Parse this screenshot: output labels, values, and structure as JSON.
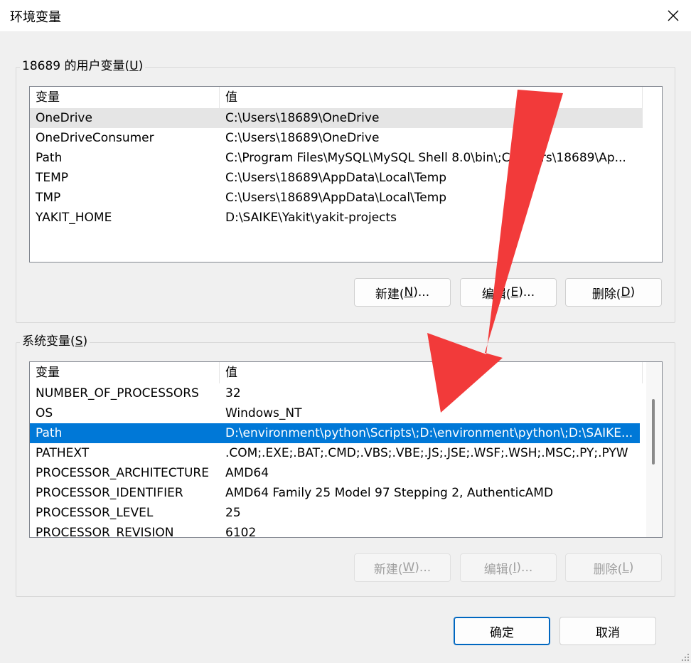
{
  "window": {
    "title": "环境变量"
  },
  "user_vars": {
    "group_label_prefix": "18689 的用户变量(",
    "group_label_accel": "U",
    "group_label_suffix": ")",
    "columns": [
      "变量",
      "值"
    ],
    "rows": [
      {
        "name": "OneDrive",
        "value": "C:\\Users\\18689\\OneDrive"
      },
      {
        "name": "OneDriveConsumer",
        "value": "C:\\Users\\18689\\OneDrive"
      },
      {
        "name": "Path",
        "value": "C:\\Program Files\\MySQL\\MySQL Shell 8.0\\bin\\;C:\\Users\\18689\\Ap..."
      },
      {
        "name": "TEMP",
        "value": "C:\\Users\\18689\\AppData\\Local\\Temp"
      },
      {
        "name": "TMP",
        "value": "C:\\Users\\18689\\AppData\\Local\\Temp"
      },
      {
        "name": "YAKIT_HOME",
        "value": "D:\\SAIKE\\Yakit\\yakit-projects"
      }
    ],
    "buttons": {
      "new": {
        "pre": "新建(",
        "accel": "N",
        "post": ")..."
      },
      "edit": {
        "pre": "编辑(",
        "accel": "E",
        "post": ")..."
      },
      "delete": {
        "pre": "删除(",
        "accel": "D",
        "post": ")"
      }
    }
  },
  "system_vars": {
    "group_label_prefix": "系统变量(",
    "group_label_accel": "S",
    "group_label_suffix": ")",
    "columns": [
      "变量",
      "值"
    ],
    "rows": [
      {
        "name": "NUMBER_OF_PROCESSORS",
        "value": "32"
      },
      {
        "name": "OS",
        "value": "Windows_NT"
      },
      {
        "name": "Path",
        "value": "D:\\environment\\python\\Scripts\\;D:\\environment\\python\\;D:\\SAIKE..."
      },
      {
        "name": "PATHEXT",
        "value": ".COM;.EXE;.BAT;.CMD;.VBS;.VBE;.JS;.JSE;.WSF;.WSH;.MSC;.PY;.PYW"
      },
      {
        "name": "PROCESSOR_ARCHITECTURE",
        "value": "AMD64"
      },
      {
        "name": "PROCESSOR_IDENTIFIER",
        "value": "AMD64 Family 25 Model 97 Stepping 2, AuthenticAMD"
      },
      {
        "name": "PROCESSOR_LEVEL",
        "value": "25"
      },
      {
        "name": "PROCESSOR_REVISION",
        "value": "6102"
      }
    ],
    "selected_row": 2,
    "buttons": {
      "new": {
        "pre": "新建(",
        "accel": "W",
        "post": ")..."
      },
      "edit": {
        "pre": "编辑(",
        "accel": "I",
        "post": ")..."
      },
      "delete": {
        "pre": "删除(",
        "accel": "L",
        "post": ")"
      }
    }
  },
  "footer": {
    "ok": "确定",
    "cancel": "取消"
  },
  "colors": {
    "selection": "#0078d7",
    "arrow": "#f23a3a",
    "primary_border": "#0067c0"
  },
  "icons": {
    "close": "close-icon",
    "resize": "resize-grip-icon"
  }
}
